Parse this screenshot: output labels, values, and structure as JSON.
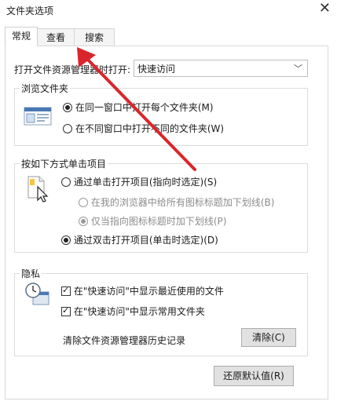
{
  "window": {
    "title": "文件夹选项"
  },
  "tabs": [
    {
      "label": "常规",
      "active": true
    },
    {
      "label": "查看",
      "active": false
    },
    {
      "label": "搜索",
      "active": false
    }
  ],
  "open_explorer": {
    "label": "打开文件资源管理器时打开:",
    "value": "快速访问"
  },
  "browse_folders": {
    "legend": "浏览文件夹",
    "options": [
      {
        "label": "在同一窗口中打开每个文件夹(M)",
        "checked": true
      },
      {
        "label": "在不同窗口中打开不同的文件夹(W)",
        "checked": false
      }
    ]
  },
  "click_items": {
    "legend": "按如下方式单击项目",
    "single_click": {
      "label": "通过单击打开项目(指向时选定)(S)",
      "checked": false
    },
    "underline_browser": {
      "label": "在我的浏览器中给所有图标标题加下划线(B)",
      "checked": false,
      "disabled": true
    },
    "underline_point": {
      "label": "仅当指向图标标题时加下划线(P)",
      "checked": true,
      "disabled": true
    },
    "double_click": {
      "label": "通过双击打开项目(单击时选定)(D)",
      "checked": true
    }
  },
  "privacy": {
    "legend": "隐私",
    "recent_files": {
      "label": "在\"快速访问\"中显示最近使用的文件",
      "checked": true
    },
    "frequent_folders": {
      "label": "在\"快速访问\"中显示常用文件夹",
      "checked": true
    },
    "clear_history_label": "清除文件资源管理器历史记录",
    "clear_button": "清除(C)"
  },
  "restore_defaults_button": "还原默认值(R)",
  "colors": {
    "arrow": "#d9262c",
    "accent": "#0078d7"
  }
}
